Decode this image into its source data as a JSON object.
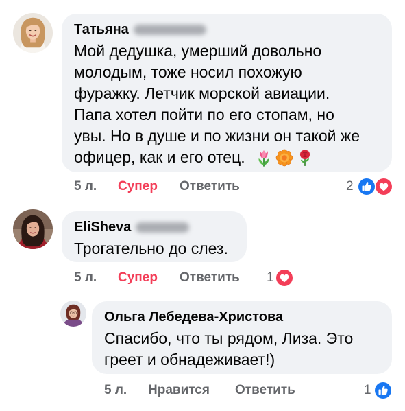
{
  "colors": {
    "bubble": "#f0f2f5",
    "text": "#050505",
    "meta": "#65676b",
    "love": "#f33e58",
    "like": "#1877f2"
  },
  "comments": [
    {
      "author": "Татьяна",
      "text_lines": [
        "Мой дедушка, умерший довольно",
        "молодым, тоже носил похожую",
        "фуражку. Летчик морской авиации.",
        "Папа хотел пойти по его стопам, но",
        "увы. Но в душе и по жизни он такой же",
        "офицер, как и его отец."
      ],
      "emojis": [
        "tulip-icon",
        "rosette-icon",
        "rose-icon"
      ],
      "time": "5 л.",
      "react_label": "Супер",
      "reply_label": "Ответить",
      "reaction_count": "2",
      "reaction_icons": [
        "like-icon",
        "love-icon"
      ]
    },
    {
      "author": "EliSheva",
      "text_lines": [
        "Трогательно до слез."
      ],
      "time": "5 л.",
      "react_label": "Супер",
      "reply_label": "Ответить",
      "reaction_count": "1",
      "reaction_icons": [
        "love-icon"
      ],
      "replies": [
        {
          "author": "Ольга Лебедева-Христова",
          "text_lines": [
            "Спасибо, что ты рядом, Лиза. Это",
            "греет и обнадеживает!)"
          ],
          "time": "5 л.",
          "react_label": "Нравится",
          "reply_label": "Ответить",
          "reaction_count": "1",
          "reaction_icons": [
            "like-icon"
          ]
        }
      ]
    }
  ]
}
